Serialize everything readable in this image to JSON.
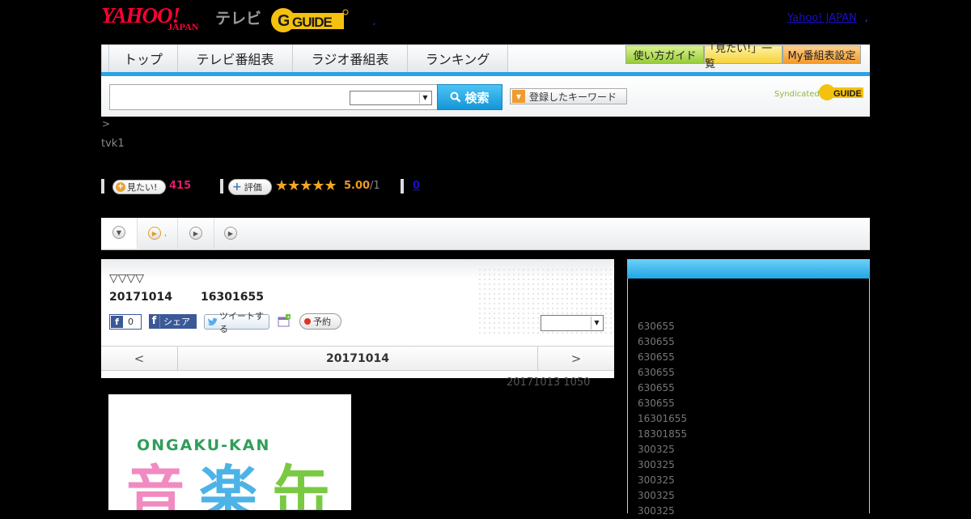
{
  "header": {
    "logo_yahoo": "YAHOO!",
    "logo_japan": "JAPAN",
    "logo_tv": "テレビ",
    "logo_gguide": "G-GUIDE",
    "yahoo_japan_link": "Yahoo! JAPAN",
    "separator_mid": ",",
    "separator_right": ","
  },
  "nav": {
    "tabs": [
      "トップ",
      "テレビ番組表",
      "ラジオ番組表",
      "ランキング"
    ],
    "guide_buttons": [
      "使い方ガイド",
      "「見たい!」一覧",
      "My番組表設定"
    ]
  },
  "search": {
    "input_value": "",
    "select_value": "",
    "button_label": "検索",
    "keyword_button": "登録したキーワード",
    "syndicated_label": "Syndicated"
  },
  "breadcrumb": ">",
  "channel": "tvk1",
  "rating": {
    "want_label": "見たい!",
    "want_count": "415",
    "review_label": "評価",
    "stars": "★★★★★",
    "score": "5.00",
    "score_denominator": "/1",
    "comments": "0"
  },
  "subtabs": {
    "second_label": ","
  },
  "program": {
    "title": "▽▽▽▽",
    "date": "20171014",
    "time": "16301655",
    "fb_like_count": "0",
    "share_label": "シェア",
    "tweet_label": "ツイートする",
    "reserve_label": "予約",
    "select_value": "",
    "prev": "<",
    "current_date": "20171014",
    "next": ">",
    "updated": "20171013  1050"
  },
  "image": {
    "ongaku_text": "ONGAKU-KAN",
    "kanji": [
      "音",
      "楽",
      "缶"
    ],
    "colors": [
      "#f08ac0",
      "#4db3e6",
      "#7ac943"
    ]
  },
  "sidebar": {
    "title": "",
    "items": [
      "630655",
      "630655",
      "630655",
      "630655",
      "630655",
      "630655",
      "16301655",
      "18301855",
      "300325",
      "300325",
      "300325",
      "300325",
      "300325"
    ]
  },
  "colors": {
    "accent_blue": "#2aa3e6",
    "yahoo_red": "#ff0033",
    "want_pink": "#e6196b",
    "star_orange": "#f5a623"
  }
}
